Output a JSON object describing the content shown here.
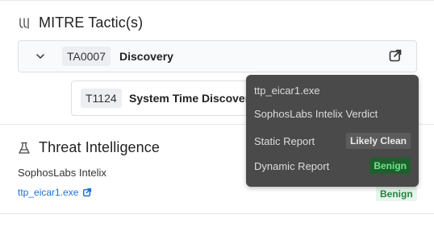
{
  "mitre": {
    "icon": "mitre-tactic-icon",
    "title": "MITRE Tactic(s)",
    "tactic": {
      "id": "TA0007",
      "name": "Discovery",
      "icon": "external-link-icon"
    },
    "technique": {
      "id": "T1124",
      "name": "System Time Discovery"
    }
  },
  "threat_intel": {
    "icon": "flask-icon",
    "title": "Threat Intelligence",
    "provider": "SophosLabs Intelix",
    "file_link": "ttp_eicar1.exe",
    "verdict": "Benign"
  },
  "tooltip": {
    "file": "ttp_eicar1.exe",
    "verdict_title": "SophosLabs Intelix Verdict",
    "static_label": "Static Report",
    "static_value": "Likely Clean",
    "dynamic_label": "Dynamic Report",
    "dynamic_value": "Benign"
  },
  "colors": {
    "link": "#1f6fd1",
    "benign_bg": "#e8f6ec",
    "benign_text": "#23843e",
    "tooltip_bg": "#4a4a4a"
  }
}
